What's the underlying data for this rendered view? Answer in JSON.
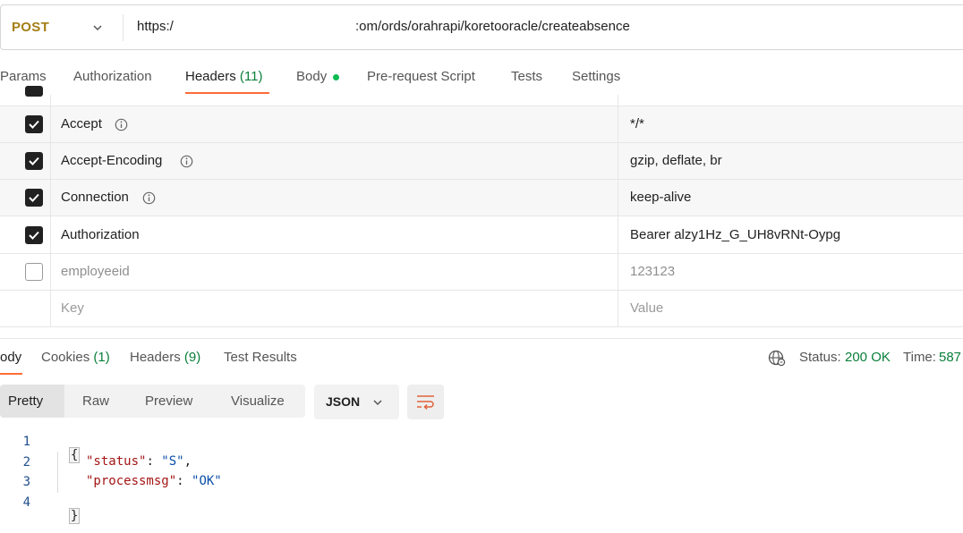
{
  "request": {
    "method": "POST",
    "url_prefix": "https:/",
    "url_suffix": ":om/ords/orahrapi/koretooracle/createabsence"
  },
  "request_tabs": {
    "params": "Params",
    "authorization": "Authorization",
    "headers": "Headers",
    "headers_count": "(11)",
    "body": "Body",
    "pre_request": "Pre-request Script",
    "tests": "Tests",
    "settings": "Settings"
  },
  "headers": [
    {
      "key": "Accept",
      "value": "*/*",
      "checked": true
    },
    {
      "key": "Accept-Encoding",
      "value": "gzip, deflate, br",
      "checked": true
    },
    {
      "key": "Connection",
      "value": "keep-alive",
      "checked": true
    },
    {
      "key": "Authorization",
      "value": "Bearer alzy1Hz_G_UH8vRNt-Oypg",
      "checked": true
    },
    {
      "key": "employeeid",
      "value": "123123",
      "checked": false
    }
  ],
  "new_row": {
    "key_placeholder": "Key",
    "value_placeholder": "Value"
  },
  "response_tabs": {
    "body": "ody",
    "cookies": "Cookies",
    "cookies_count": "(1)",
    "headers": "Headers",
    "headers_count": "(9)",
    "test_results": "Test Results"
  },
  "response_status": {
    "status_label": "Status:",
    "status_value": "200 OK",
    "time_label": "Time:",
    "time_value": "587"
  },
  "view_modes": {
    "pretty": "Pretty",
    "raw": "Raw",
    "preview": "Preview",
    "visualize": "Visualize"
  },
  "format": "JSON",
  "code": {
    "line_numbers": [
      "1",
      "2",
      "3",
      "4"
    ],
    "open_brace": "{",
    "close_brace": "}",
    "key1": "\"status\"",
    "val1": "\"S\"",
    "key2": "\"processmsg\"",
    "val2": "\"OK\""
  },
  "colors": {
    "accent": "#ff6c37",
    "method": "#a47e13",
    "success": "#0a7f3a",
    "dot": "#0cbb52"
  }
}
